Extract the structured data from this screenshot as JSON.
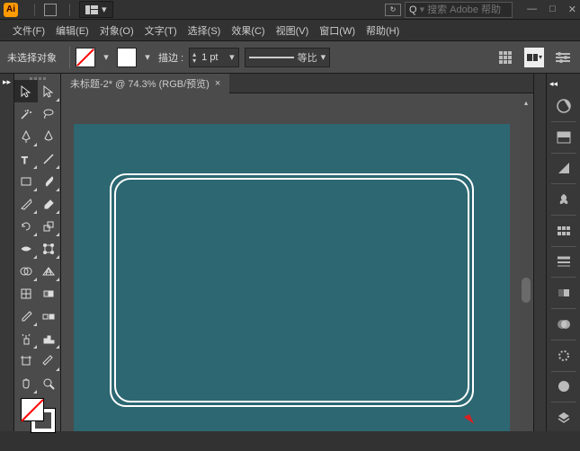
{
  "titlebar": {
    "app": "Ai",
    "search_placeholder": "搜索 Adobe 帮助",
    "search_prefix": "Q"
  },
  "menu": [
    "文件(F)",
    "编辑(E)",
    "对象(O)",
    "文字(T)",
    "选择(S)",
    "效果(C)",
    "视图(V)",
    "窗口(W)",
    "帮助(H)"
  ],
  "control": {
    "no_selection": "未选择对象",
    "stroke_label": "描边 :",
    "stroke_value": "1 pt",
    "profile_label": "等比"
  },
  "document": {
    "tab_title": "未标题-2* @ 74.3% (RGB/预览)"
  }
}
